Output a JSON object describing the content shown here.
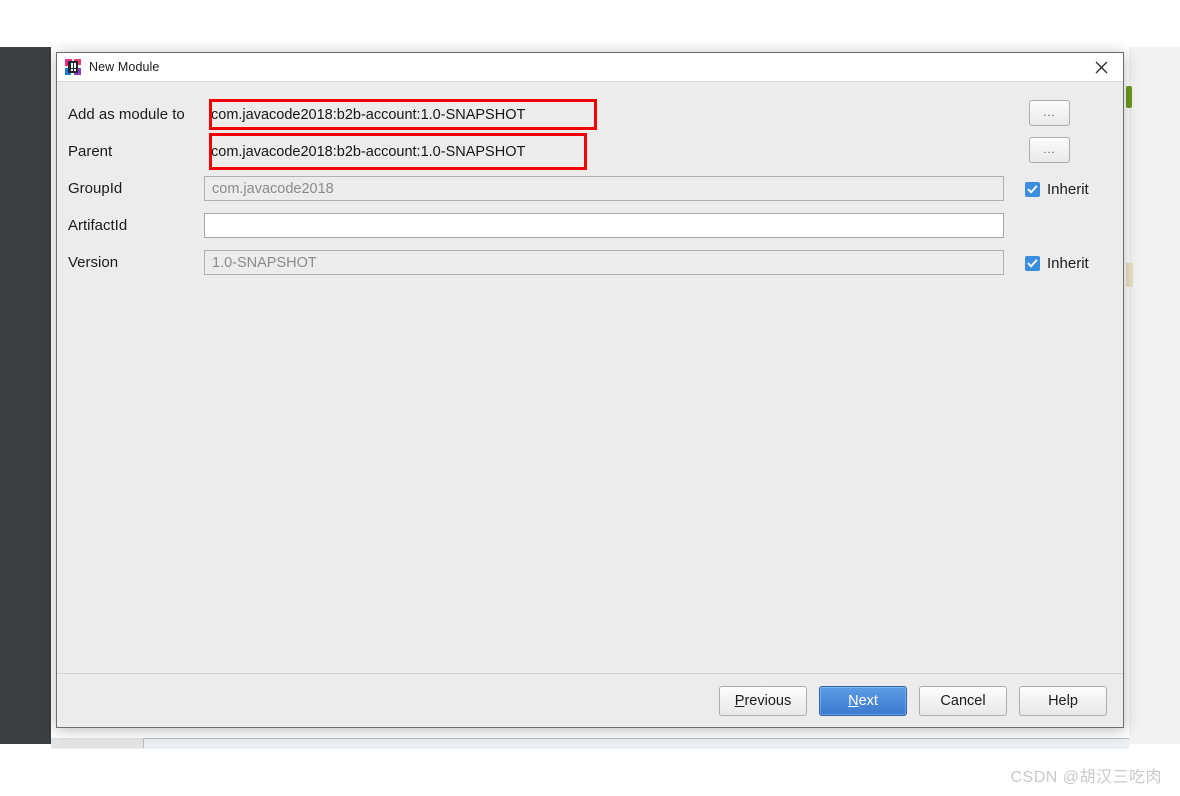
{
  "window": {
    "title": "New Module",
    "icon": "intellij-idea-icon",
    "close_icon": "close-icon"
  },
  "form": {
    "rows": [
      {
        "label": "Add as module to",
        "value": "com.javacode2018:b2b-account:1.0-SNAPSHOT",
        "state": "plain",
        "highlighted": true,
        "browse_label": "...",
        "inherit": null
      },
      {
        "label": "Parent",
        "value": "com.javacode2018:b2b-account:1.0-SNAPSHOT",
        "state": "plain",
        "highlighted": true,
        "browse_label": "...",
        "inherit": null
      },
      {
        "label": "GroupId",
        "value": "com.javacode2018",
        "state": "readonly",
        "highlighted": false,
        "browse_label": null,
        "inherit": {
          "label": "Inherit",
          "checked": true
        }
      },
      {
        "label": "ArtifactId",
        "value": "",
        "placeholder": "",
        "state": "editable",
        "highlighted": false,
        "browse_label": null,
        "inherit": null
      },
      {
        "label": "Version",
        "value": "1.0-SNAPSHOT",
        "state": "readonly",
        "highlighted": false,
        "browse_label": null,
        "inherit": {
          "label": "Inherit",
          "checked": true
        }
      }
    ]
  },
  "footer": {
    "previous_label": "Previous",
    "previous_mnemonic": "P",
    "next_label": "Next",
    "next_mnemonic": "N",
    "cancel_label": "Cancel",
    "help_label": "Help"
  },
  "annotation": {
    "box_color": "#f50000",
    "count": 2
  },
  "watermark": {
    "text": "CSDN @胡汉三吃肉"
  }
}
